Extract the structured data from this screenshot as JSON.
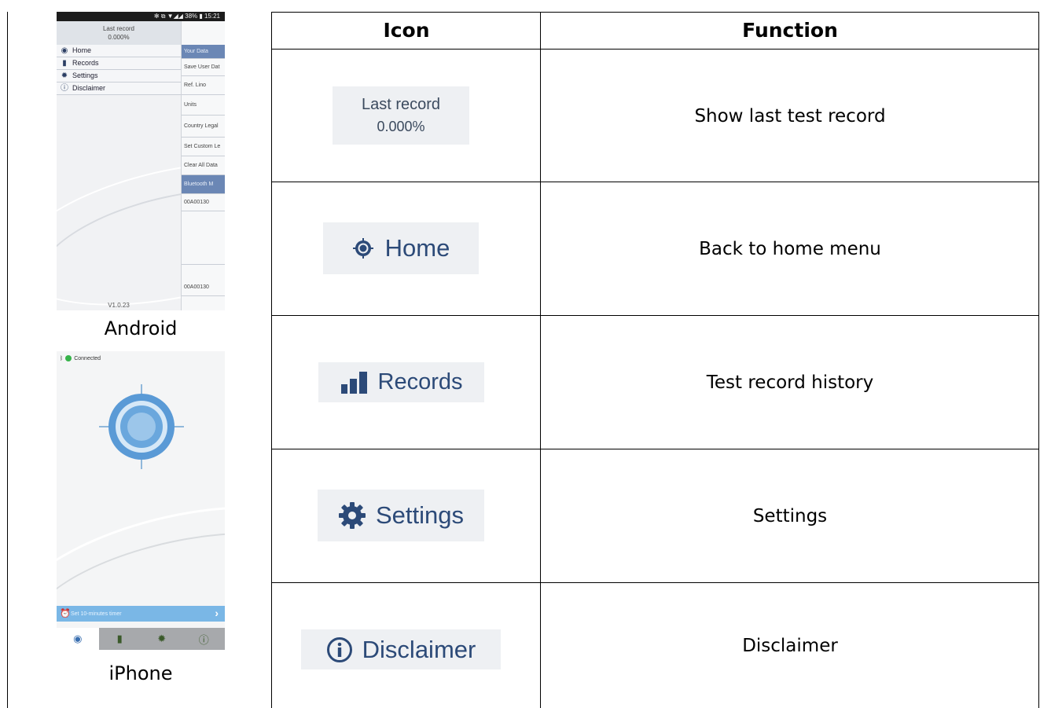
{
  "header": {
    "icon": "Icon",
    "function": "Function"
  },
  "android": {
    "caption": "Android",
    "status": "✻ ⧉ ▼◢◢ 38% ▮ 15:21",
    "last_record_label": "Last record",
    "last_record_value": "0.000%",
    "menu": [
      {
        "icon": "home-icon",
        "label": "Home"
      },
      {
        "icon": "records-icon",
        "label": "Records"
      },
      {
        "icon": "settings-icon",
        "label": "Settings"
      },
      {
        "icon": "info-icon",
        "label": "Disclaimer"
      }
    ],
    "panel": [
      "Your Data",
      "Save User Dat",
      "Ref. Lino",
      "Units",
      "Country Legal",
      "Set Custom Le",
      "Clear All Data",
      "Bluetooth M",
      "00A00130",
      "00A00130"
    ],
    "version": "V1.0.23"
  },
  "iphone": {
    "caption": "iPhone",
    "status": "Connected",
    "timer": "Set 10-minutes timer"
  },
  "rows": [
    {
      "chip_type": "last-record",
      "chip_line1": "Last record",
      "chip_line2": "0.000%",
      "function": "Show last test record"
    },
    {
      "chip_type": "home",
      "chip_label": "Home",
      "function": "Back to home menu"
    },
    {
      "chip_type": "records",
      "chip_label": "Records",
      "function": "Test record history"
    },
    {
      "chip_type": "settings",
      "chip_label": "Settings",
      "function": "Settings"
    },
    {
      "chip_type": "disclaimer",
      "chip_label": "Disclaimer",
      "function": "Disclaimer"
    }
  ],
  "colors": {
    "accent": "#2c4a78",
    "chip_bg": "#eef0f3",
    "iphone_bar": "#7ab7e6",
    "connected": "#36b34a"
  }
}
